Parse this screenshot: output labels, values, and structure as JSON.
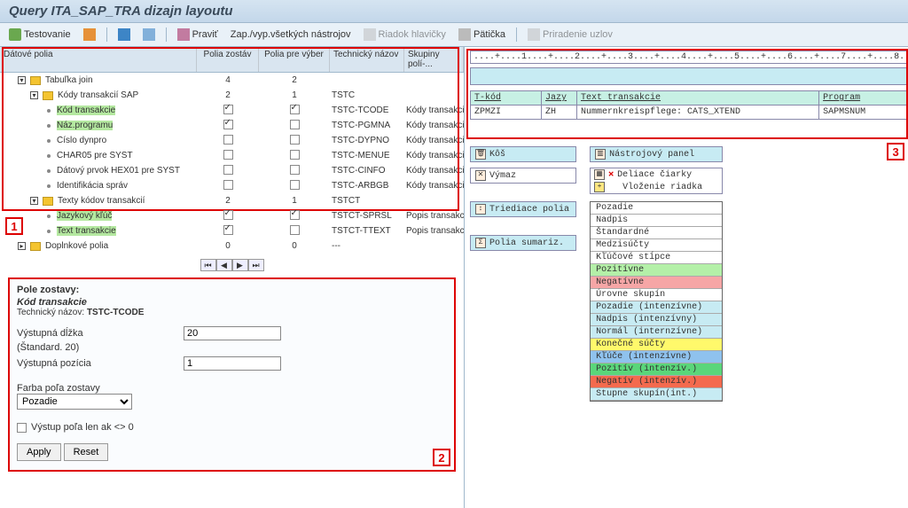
{
  "title": "Query ITA_SAP_TRA dizajn layoutu",
  "toolbar": {
    "test": "Testovanie",
    "edit": "Praviť",
    "toggle_tools": "Zap./vyp.všetkých nástrojov",
    "header_row": "Riadok hlavičky",
    "footer": "Pätička",
    "assign_nodes": "Priradenie uzlov"
  },
  "tree": {
    "headers": [
      "Dátové polia",
      "Polia zostáv",
      "Polia pre výber",
      "Technický názov",
      "Skupiny polí-..."
    ],
    "rows": [
      {
        "lvl": 1,
        "exp": "▾",
        "type": "folder",
        "label": "Tabuľka join",
        "c1": "4",
        "c2": "2",
        "c3": "",
        "c4": ""
      },
      {
        "lvl": 2,
        "exp": "▾",
        "type": "folder",
        "label": "Kódy transakcií SAP",
        "c1": "2",
        "c2": "1",
        "c3": "TSTC",
        "c4": ""
      },
      {
        "lvl": 3,
        "type": "leaf",
        "label": "Kód transakcie",
        "hl": true,
        "c1": "chk",
        "c2": "chk",
        "c3": "TSTC-TCODE",
        "c4": "Kódy transakcií ..."
      },
      {
        "lvl": 3,
        "type": "leaf",
        "label": "Náz.programu",
        "hl": true,
        "c1": "chk",
        "c2": "off",
        "c3": "TSTC-PGMNA",
        "c4": "Kódy transakcií ..."
      },
      {
        "lvl": 3,
        "type": "leaf",
        "label": "Číslo dynpro",
        "c1": "off",
        "c2": "off",
        "c3": "TSTC-DYPNO",
        "c4": "Kódy transakcií ..."
      },
      {
        "lvl": 3,
        "type": "leaf",
        "label": "CHAR05 pre SYST",
        "c1": "off",
        "c2": "off",
        "c3": "TSTC-MENUE",
        "c4": "Kódy transakcií ..."
      },
      {
        "lvl": 3,
        "type": "leaf",
        "label": "Dátový prvok HEX01 pre SYST",
        "c1": "off",
        "c2": "off",
        "c3": "TSTC-CINFO",
        "c4": "Kódy transakcií ..."
      },
      {
        "lvl": 3,
        "type": "leaf",
        "label": "Identifikácia správ",
        "c1": "off",
        "c2": "off",
        "c3": "TSTC-ARBGB",
        "c4": "Kódy transakcií ..."
      },
      {
        "lvl": 2,
        "exp": "▾",
        "type": "folder",
        "label": "Texty kódov transakcií",
        "c1": "2",
        "c2": "1",
        "c3": "TSTCT",
        "c4": ""
      },
      {
        "lvl": 3,
        "type": "leaf",
        "label": "Jazykový kľúč",
        "hl": true,
        "c1": "chk",
        "c2": "chk",
        "c3": "TSTCT-SPRSL",
        "c4": "Popis transakcií ..."
      },
      {
        "lvl": 3,
        "type": "leaf",
        "label": "Text transakcie",
        "hl": true,
        "c1": "chk",
        "c2": "off",
        "c3": "TSTCT-TTEXT",
        "c4": "Popis transakcií ..."
      },
      {
        "lvl": 1,
        "exp": "▸",
        "type": "folder",
        "label": "Doplnkové polia",
        "c1": "0",
        "c2": "0",
        "c3": "---",
        "c4": ""
      }
    ]
  },
  "field_panel": {
    "title": "Pole zostavy:",
    "name": "Kód transakcie",
    "tech_label": "Technický názov:",
    "tech_value": "TSTC-TCODE",
    "out_len_label": "Výstupná dĺžka",
    "out_len_value": "20",
    "std_label": "(Štandard. 20)",
    "out_pos_label": "Výstupná pozícia",
    "out_pos_value": "1",
    "color_label": "Farba poľa zostavy",
    "color_value": "Pozadie",
    "out_if_label": "Výstup poľa len ak <> 0",
    "apply": "Apply",
    "reset": "Reset"
  },
  "preview": {
    "ruler": "....+....1....+....2....+....3....+....4....+....5....+....6....+....7....+....8.",
    "hdr": [
      "T-kód",
      "Jazy",
      "Text transakcie",
      "Program"
    ],
    "row": [
      "ZPMZI",
      "ZH",
      "Nummernkreispflege: CATS_XTEND",
      "SAPMSNUM"
    ]
  },
  "tools": {
    "trash": "Kôš",
    "delete": "Výmaz",
    "sort_fields": "Triediace polia",
    "sum_fields": "Polia sumariz.",
    "toolbar_panel": "Nástrojový panel",
    "del_sep": "Deliace čiarky",
    "ins_row": "Vloženie riadka"
  },
  "colors": [
    {
      "t": "Pozadie",
      "bg": "#ffffff"
    },
    {
      "t": "Nadpis",
      "bg": "#ffffff"
    },
    {
      "t": "Štandardné",
      "bg": "#ffffff"
    },
    {
      "t": "Medzisúčty",
      "bg": "#ffffff"
    },
    {
      "t": "Kľúčové stĺpce",
      "bg": "#ffffff"
    },
    {
      "t": "Pozitívne",
      "bg": "#b4f0a8"
    },
    {
      "t": "Negatívne",
      "bg": "#f6a6a6"
    },
    {
      "t": "Úrovne skupín",
      "bg": "#ffffff"
    },
    {
      "t": "Pozadie (intenzívne)",
      "bg": "#c7ebf3"
    },
    {
      "t": "Nadpis (intenzívny)",
      "bg": "#c7ebf3"
    },
    {
      "t": "Normál (internzívne)",
      "bg": "#c7ebf3"
    },
    {
      "t": "Konečné súčty",
      "bg": "#fff96b"
    },
    {
      "t": "Kľúče (intenzívne)",
      "bg": "#8fc2ee"
    },
    {
      "t": "Pozitív (intenzív.)",
      "bg": "#5ad67a"
    },
    {
      "t": "Negatív (intenzív.)",
      "bg": "#f46a4e"
    },
    {
      "t": "Stupne skupín(int.)",
      "bg": "#c7ebf3"
    }
  ],
  "callouts": {
    "c1": "1",
    "c2": "2",
    "c3": "3"
  }
}
